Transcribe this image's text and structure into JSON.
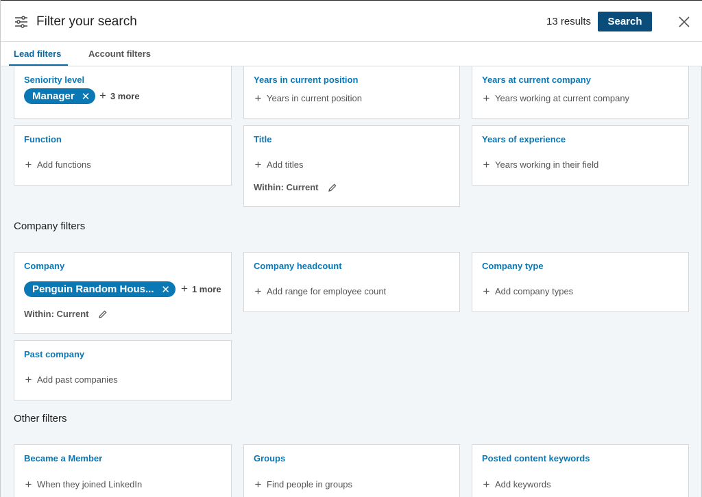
{
  "header": {
    "title": "Filter your search",
    "results": "13 results",
    "search_label": "Search",
    "icons": {
      "filter": "filter-sliders-icon",
      "close": "close-icon"
    }
  },
  "tabs": [
    {
      "label": "Lead filters",
      "active": true
    },
    {
      "label": "Account filters",
      "active": false
    }
  ],
  "lead_filters": {
    "seniority": {
      "title": "Seniority level",
      "pill": "Manager",
      "more": "3 more"
    },
    "years_position": {
      "title": "Years in current position",
      "add": "Years in current position"
    },
    "years_company": {
      "title": "Years at current company",
      "add": "Years working at current company"
    },
    "function": {
      "title": "Function",
      "add": "Add functions"
    },
    "title": {
      "title": "Title",
      "add": "Add titles",
      "within": "Within: Current"
    },
    "years_experience": {
      "title": "Years of experience",
      "add": "Years working in their field"
    }
  },
  "company_filters": {
    "heading": "Company filters",
    "company": {
      "title": "Company",
      "pill": "Penguin Random Hous...",
      "more": "1 more",
      "within": "Within: Current"
    },
    "headcount": {
      "title": "Company headcount",
      "add": "Add range for employee count"
    },
    "type": {
      "title": "Company type",
      "add": "Add company types"
    },
    "past": {
      "title": "Past company",
      "add": "Add past companies"
    }
  },
  "other_filters": {
    "heading": "Other filters",
    "member": {
      "title": "Became a Member",
      "add": "When they joined LinkedIn"
    },
    "groups": {
      "title": "Groups",
      "add": "Find people in groups"
    },
    "keywords": {
      "title": "Posted content keywords",
      "add": "Add keywords"
    }
  },
  "colors": {
    "accent": "#0a78b4",
    "button": "#0a4d7b",
    "background": "#f3f6f8"
  }
}
